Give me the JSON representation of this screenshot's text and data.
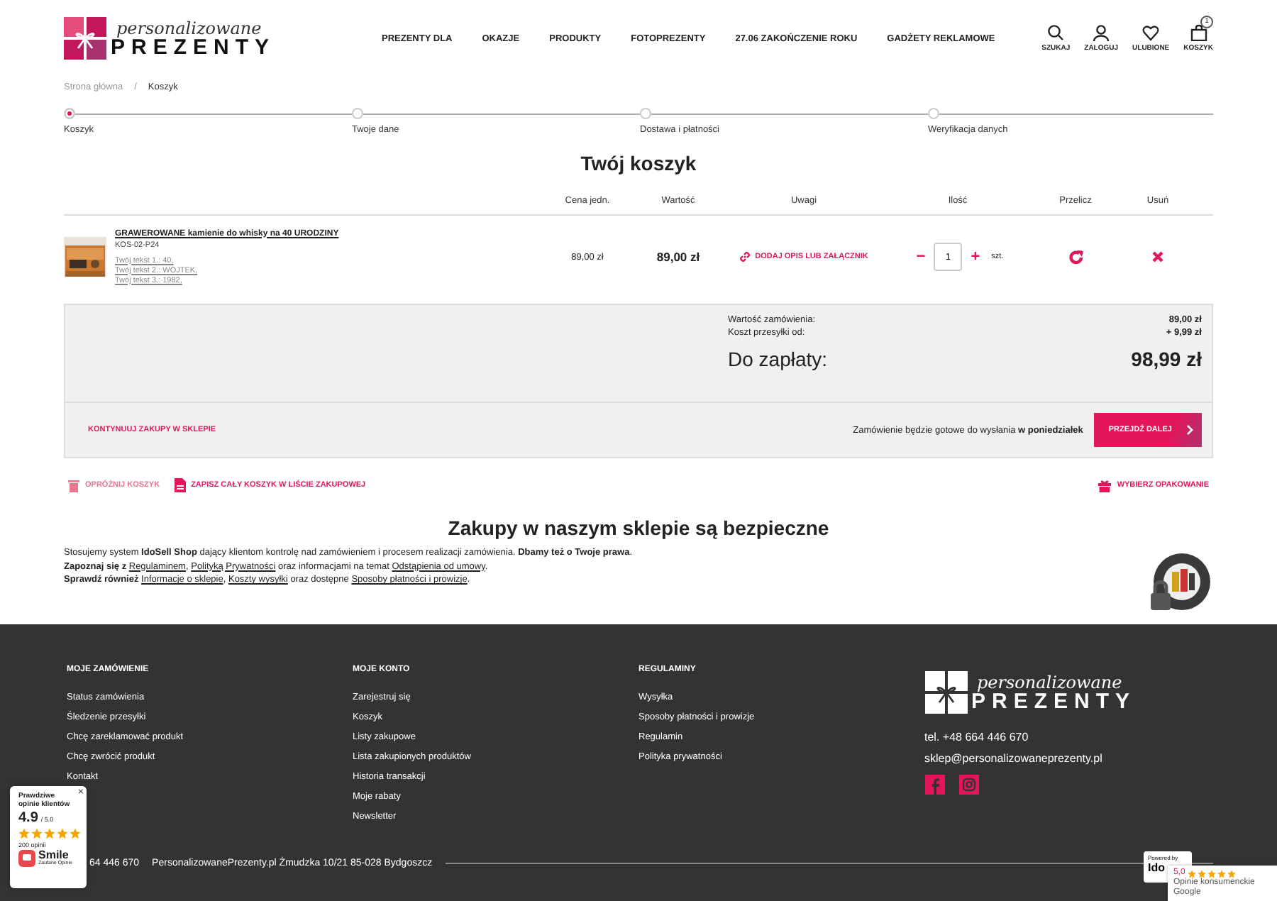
{
  "header": {
    "logo": {
      "script": "personalizowane",
      "main": "PREZENTY"
    },
    "nav": [
      "PREZENTY DLA",
      "OKAZJE",
      "PRODUKTY",
      "FOTOPREZENTY",
      "27.06 ZAKOŃCZENIE ROKU",
      "GADŻETY REKLAMOWE"
    ],
    "actions": [
      {
        "kind": "search",
        "label": "SZUKAJ"
      },
      {
        "kind": "user",
        "label": "ZALOGUJ"
      },
      {
        "kind": "heart",
        "label": "ULUBIONE"
      },
      {
        "kind": "bag",
        "label": "KOSZYK",
        "count": "1"
      }
    ]
  },
  "breadcrumb": [
    "Strona główna",
    "Koszyk"
  ],
  "breadcrumb_separator": "/",
  "steps": [
    {
      "label": "Koszyk",
      "selected": true
    },
    {
      "label": "Twoje dane",
      "selected": false
    },
    {
      "label": "Dostawa i płatności",
      "selected": false
    },
    {
      "label": "Weryfikacja danych",
      "selected": false
    }
  ],
  "title": "Twój koszyk",
  "table": {
    "columns": [
      "Cena jedn.",
      "Wartość",
      "Uwagi",
      "Ilość",
      "Przelicz",
      "Usuń"
    ],
    "rows": [
      {
        "name": "GRAWEROWANE kamienie do whisky na 40 URODZINY",
        "code": "KOS-02-P24",
        "options": [
          "Twój tekst 1.: 40,",
          "Twój tekst 2.: WOJTEK,",
          "Twój tekst 3.: 1982,"
        ],
        "price": "89,00 zł",
        "value": "89,00 zł",
        "note_link": "DODAJ OPIS LUB ZAŁĄCZNIK",
        "minus": "−",
        "quantity": "1",
        "plus": "+",
        "unit": "szt."
      }
    ]
  },
  "summary": {
    "lines": [
      {
        "label": "Wartość zamówienia:",
        "value": "89,00 zł"
      },
      {
        "label": "Koszt przesyłki od:",
        "value": "+ 9,99 zł"
      }
    ],
    "total_label": "Do zapłaty:",
    "total_value": "98,99 zł"
  },
  "continue_link": "KONTYNUUJ ZAKUPY W SKLEPIE",
  "ready_note": "Zamówienie będzie gotowe do wysłania **w poniedziałek**",
  "next_button": "PRZEJDŹ DALEJ",
  "cart_actions": [
    {
      "kind": "trash",
      "label": "OPRÓŻNIJ KOSZYK"
    },
    {
      "kind": "file",
      "label": "ZAPISZ CAŁY KOSZYK W LIŚCIE ZAKUPOWEJ"
    },
    {
      "kind": "gift",
      "label": "WYBIERZ OPAKOWANIE"
    }
  ],
  "secure": {
    "title": "Zakupy w naszym sklepie są bezpieczne",
    "paragraphs": [
      [
        {
          "kind": "text",
          "text": "Stosujemy system "
        },
        {
          "kind": "bold",
          "text": "IdoSell Shop"
        },
        {
          "kind": "text",
          "text": " dający klientom kontrolę nad zamówieniem i procesem realizacji zamówienia. "
        },
        {
          "kind": "bold",
          "text": "Dbamy też o Twoje prawa"
        },
        {
          "kind": "text",
          "text": "."
        }
      ],
      [
        {
          "kind": "bold",
          "text": "Zapoznaj się z "
        },
        {
          "kind": "link",
          "text": "Regulaminem",
          "after": ", "
        },
        {
          "kind": "link",
          "text": "Polityką Prywatności"
        },
        {
          "kind": "text",
          "text": " oraz informacjami na temat "
        },
        {
          "kind": "link",
          "text": "Odstąpienia od umowy"
        },
        {
          "kind": "text",
          "text": "."
        }
      ],
      [
        {
          "kind": "bold",
          "text": "Sprawdź również "
        },
        {
          "kind": "link",
          "text": "Informacje o sklepie",
          "after": ", "
        },
        {
          "kind": "link",
          "text": "Koszty wysyłki"
        },
        {
          "kind": "text",
          "text": " oraz dostępne "
        },
        {
          "kind": "link",
          "text": "Sposoby płatności i prowizje"
        },
        {
          "kind": "text",
          "text": "."
        }
      ]
    ]
  },
  "footer": {
    "columns": [
      {
        "title": "MOJE ZAMÓWIENIE",
        "links": [
          "Status zamówienia",
          "Śledzenie przesyłki",
          "Chcę zareklamować produkt",
          "Chcę zwrócić produkt",
          "Kontakt"
        ]
      },
      {
        "title": "MOJE KONTO",
        "links": [
          "Zarejestruj się",
          "Koszyk",
          "Listy zakupowe",
          "Lista zakupionych produktów",
          "Historia transakcji",
          "Moje rabaty",
          "Newsletter"
        ]
      },
      {
        "title": "REGULAMINY",
        "links": [
          "Wysyłka",
          "Sposoby płatności i prowizje",
          "Regulamin",
          "Polityka prywatności"
        ]
      }
    ],
    "logo": {
      "script": "personalizowane",
      "main": "PREZENTY"
    },
    "phone": "tel. +48 664 446 670",
    "email": "sklep@personalizowaneprezenty.pl",
    "bottom_phone": "64 446 670",
    "address": "PersonalizowanePrezenty.pl Żmudzka 10/21 85-028 Bydgoszcz"
  },
  "reviews_widget": {
    "close": "×",
    "title": "Prawdziwe opinie klientów",
    "rating": "4.9",
    "scale": "/ 5.0",
    "stars": 5,
    "count": "200 opinii",
    "brand": "Smile",
    "brand_sub": "Zaufane Opinie"
  },
  "powered_badge": {
    "label": "Powered by",
    "brand": "Ido"
  },
  "google_widget": {
    "rating": "5,0",
    "stars": 5,
    "label": "Opinie konsumenckie",
    "brand": "Google"
  }
}
